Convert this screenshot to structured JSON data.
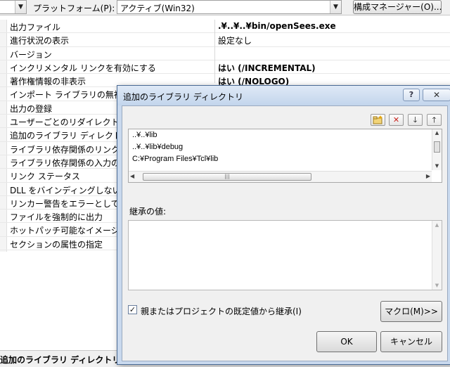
{
  "toolbar": {
    "platform_label": "プラットフォーム(P):",
    "platform_value": "アクティブ(Win32)",
    "config_manager_label": "構成マネージャー(O)..."
  },
  "grid": {
    "rows": [
      {
        "name": "出力ファイル",
        "value": ".¥..¥..¥bin/openSees.exe",
        "bold": true
      },
      {
        "name": "進行状況の表示",
        "value": "設定なし",
        "bold": false
      },
      {
        "name": "バージョン",
        "value": "",
        "bold": false
      },
      {
        "name": "インクリメンタル リンクを有効にする",
        "value": "はい (/INCREMENTAL)",
        "bold": true
      },
      {
        "name": "著作権情報の非表示",
        "value": "はい (/NOLOGO)",
        "bold": true
      },
      {
        "name": "インポート ライブラリの無視",
        "value": "",
        "bold": false
      },
      {
        "name": "出力の登録",
        "value": "",
        "bold": false
      },
      {
        "name": "ユーザーごとのリダイレクト",
        "value": "",
        "bold": false
      },
      {
        "name": "追加のライブラリ ディレクトリ",
        "value": "",
        "bold": false
      },
      {
        "name": "ライブラリ依存関係のリンク",
        "value": "",
        "bold": false
      },
      {
        "name": "ライブラリ依存関係の入力の使",
        "value": "",
        "bold": false
      },
      {
        "name": "リンク ステータス",
        "value": "",
        "bold": false
      },
      {
        "name": "DLL をバインディングしない",
        "value": "",
        "bold": false
      },
      {
        "name": "リンカー警告をエラーとして扱",
        "value": "",
        "bold": false
      },
      {
        "name": "ファイルを強制的に出力",
        "value": "",
        "bold": false
      },
      {
        "name": "ホットパッチ可能なイメージの",
        "value": "",
        "bold": false
      },
      {
        "name": "セクションの属性の指定",
        "value": "",
        "bold": false
      }
    ]
  },
  "status": {
    "text": "追加のライブラリ ディレクトリ"
  },
  "dialog": {
    "title": "追加のライブラリ ディレクトリ",
    "help_glyph": "?",
    "close_glyph": "✕",
    "directories": [
      "..¥..¥lib",
      "..¥..¥lib¥debug",
      "C:¥Program Files¥Tcl¥lib"
    ],
    "inherited_label": "継承の値:",
    "inherit_checkbox_label": "親またはプロジェクトの既定値から継承(I)",
    "inherit_checked": true,
    "macro_button": "マクロ(M)>>",
    "ok_button": "OK",
    "cancel_button": "キャンセル"
  }
}
